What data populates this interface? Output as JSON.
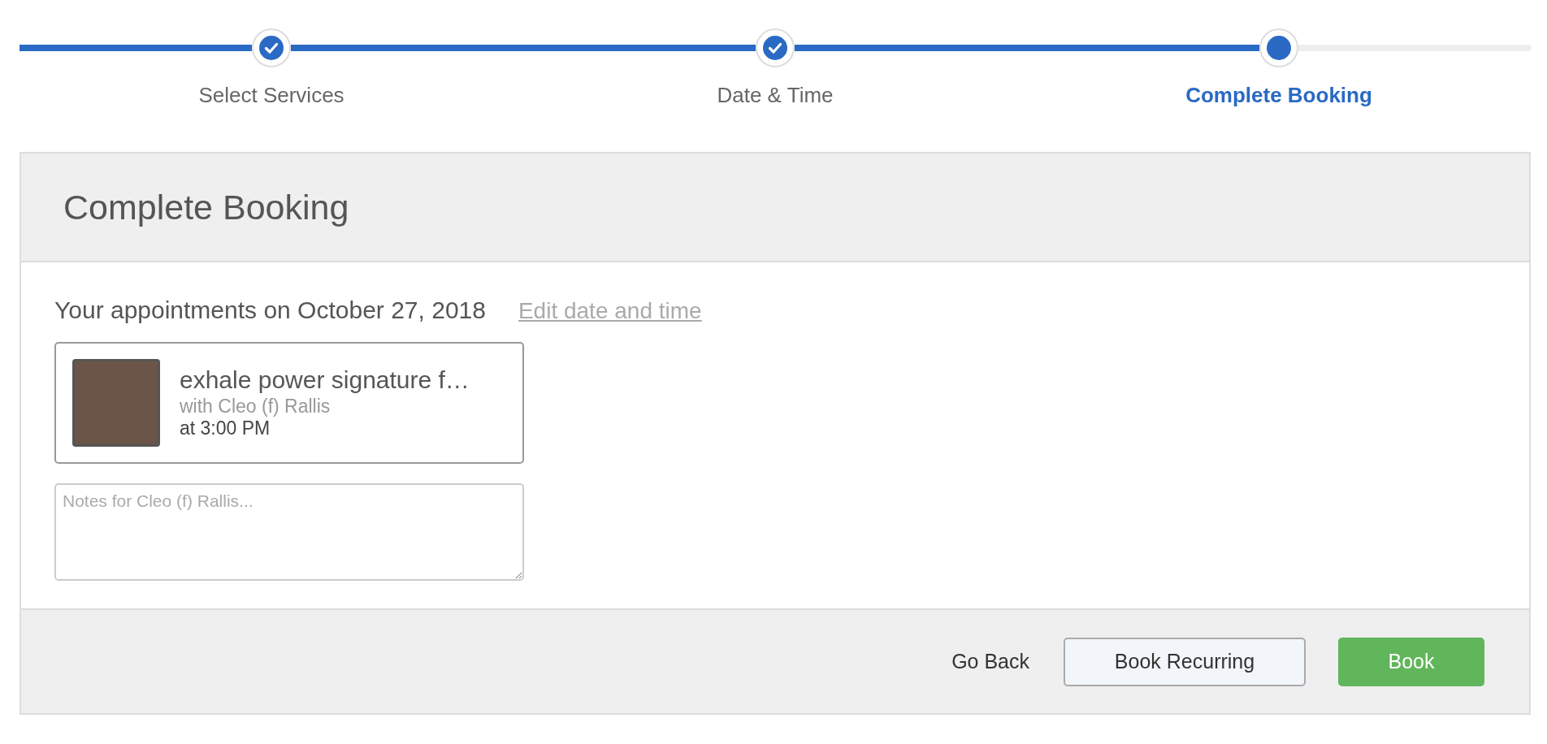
{
  "steps": [
    {
      "label": "Select Services",
      "completed": true,
      "selected": false
    },
    {
      "label": "Date & Time",
      "completed": true,
      "selected": false
    },
    {
      "label": "Complete Booking",
      "completed": false,
      "selected": true
    }
  ],
  "panel": {
    "title": "Complete Booking",
    "heading": "Your appointments on October 27, 2018",
    "edit_link": "Edit date and time",
    "appointments": [
      {
        "service": "exhale power signature f…",
        "staff": "with Cleo (f) Rallis",
        "time": "at 3:00 PM",
        "notes_placeholder": "Notes for Cleo (f) Rallis..."
      }
    ]
  },
  "footer": {
    "back_link": "Go Back",
    "secondary_button": "Book Recurring",
    "primary_button": "Book"
  }
}
